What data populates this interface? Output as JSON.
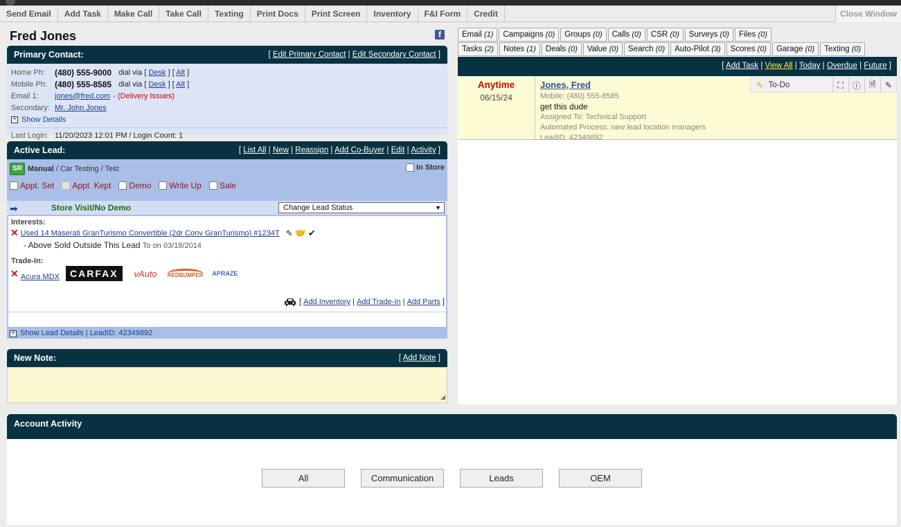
{
  "toolbar": {
    "items": [
      "Send Email",
      "Add Task",
      "Make Call",
      "Take Call",
      "Texting",
      "Print Docs",
      "Print Screen",
      "Inventory",
      "F&I Form",
      "Credit"
    ],
    "close": "Close Window"
  },
  "customer": {
    "name": "Fred Jones"
  },
  "primary_contact": {
    "title": "Primary Contact:",
    "edit_primary": "Edit Primary Contact",
    "edit_secondary": "Edit Secondary Contact",
    "home_label": "Home Ph:",
    "home_phone": "(480) 555-9000",
    "mobile_label": "Mobile Ph:",
    "mobile_phone": "(480) 555-8585",
    "dial_via": "dial via",
    "desk": "Desk",
    "alt": "Alt",
    "email_label": "Email 1:",
    "email": "jones@fred.com",
    "delivery_issue": "(Delivery Issues)",
    "secondary_label": "Secondary:",
    "secondary": "Mr. John Jones",
    "show_details": "Show Details",
    "last_login": "Last Login:",
    "last_login_value": "11/20/2023 12:01 PM / Login Count: 1"
  },
  "active_lead": {
    "title": "Active Lead:",
    "links": [
      "List All",
      "New",
      "Reassign",
      "Add Co-Buyer",
      "Edit",
      "Activity"
    ],
    "badge": "SR",
    "source": "Manual",
    "source_rest": " / Car Testing /  Test",
    "in_store": "In Store",
    "checks": [
      "Appt. Set",
      "Appt. Kept",
      "Demo",
      "Write Up",
      "Sale"
    ],
    "status": "Store Visit/No Demo",
    "change_status": "Change Lead Status",
    "interests_label": "Interests:",
    "vehicle": "Used 14 Maserati GranTurismo Convertible (2dr Conv GranTurismo) #1234T",
    "sold_note": "- Above Sold Outside This Lead",
    "sold_date": "To on 03/18/2014",
    "tradein_label": "Trade-In:",
    "tradein": "Acura MDX",
    "carfax": "CARFAX",
    "vauto": "vAuto",
    "redbumper": "REDBUMPER",
    "apraze": "APRAZE",
    "add_inventory": "Add Inventory",
    "add_tradein": "Add Trade-In",
    "add_parts": "Add Parts",
    "show_lead_details": "Show Lead Details | LeadID: 42349892"
  },
  "new_note": {
    "title": "New Note:",
    "add": "Add Note"
  },
  "tabs_row1": [
    {
      "label": "Email",
      "count": "(1)"
    },
    {
      "label": "Campaigns",
      "count": "(0)"
    },
    {
      "label": "Groups",
      "count": "(0)"
    },
    {
      "label": "Calls",
      "count": "(0)"
    },
    {
      "label": "CSR",
      "count": "(0)"
    },
    {
      "label": "Surveys",
      "count": "(0)"
    },
    {
      "label": "Files",
      "count": "(0)"
    }
  ],
  "tabs_row2": [
    {
      "label": "Tasks",
      "count": "(2)"
    },
    {
      "label": "Notes",
      "count": "(1)"
    },
    {
      "label": "Deals",
      "count": "(0)"
    },
    {
      "label": "Value",
      "count": "(0)"
    },
    {
      "label": "Search",
      "count": "(0)"
    },
    {
      "label": "Auto-Pilot",
      "count": "(3)"
    },
    {
      "label": "Scores",
      "count": "(0)"
    },
    {
      "label": "Garage",
      "count": "(0)"
    },
    {
      "label": "Texting",
      "count": "(0)"
    }
  ],
  "task_links": [
    "Add Task",
    "View All",
    "Today",
    "Overdue",
    "Future"
  ],
  "task": {
    "when": "Anytime",
    "date": "06/15/24",
    "name": "Jones, Fred",
    "mobile": "Mobile: (480) 555-8585",
    "desc": "get this dude",
    "assigned": "Assigned To: Technical Support",
    "process": "Automated Process: new lead location managers",
    "leadid": "LeadID: 42349892",
    "type": "To-Do"
  },
  "account_activity": {
    "title": "Account Activity",
    "buttons": [
      "All",
      "Communication",
      "Leads",
      "OEM"
    ]
  }
}
